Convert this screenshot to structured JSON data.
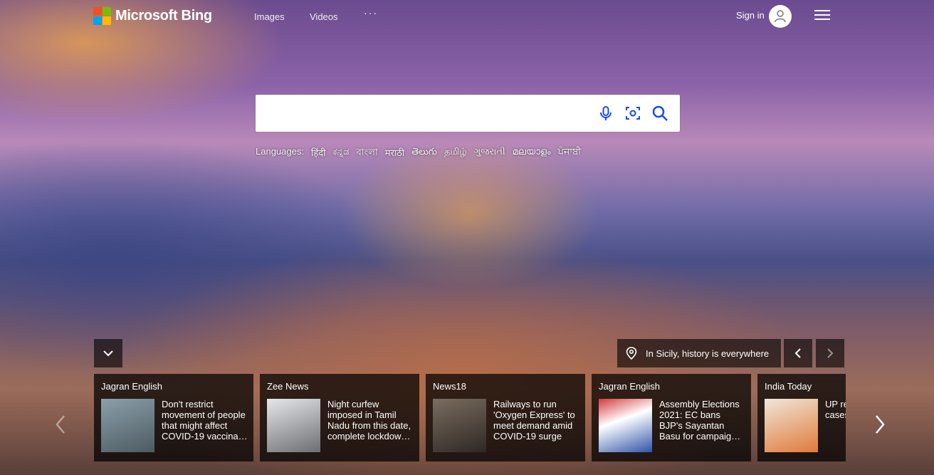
{
  "header": {
    "brand": "Microsoft Bing",
    "nav": [
      {
        "label": "Images"
      },
      {
        "label": "Videos"
      }
    ],
    "more": "···",
    "signin": "Sign in",
    "logo_colors": [
      "#f25022",
      "#7fba00",
      "#00a4ef",
      "#ffb900"
    ]
  },
  "search": {
    "placeholder": "",
    "value": ""
  },
  "languages": {
    "label": "Languages:",
    "items": [
      "हिंदी",
      "ಕನ್ನಡ",
      "বাংলা",
      "मराठी",
      "తెలుగు",
      "தமிழ்",
      "ગુજરાતી",
      "മലയാളം",
      "ਪੰਜਾਬੀ"
    ]
  },
  "image_caption": "In Sicily, history is everywhere",
  "news": [
    {
      "source": "Jagran English",
      "headline": "Don't restrict movement of people that might affect COVID-19 vaccina…",
      "thumb": "#6b7d86"
    },
    {
      "source": "Zee News",
      "headline": "Night curfew imposed in Tamil Nadu from this date, complete lockdow…",
      "thumb": "#c9cbd0"
    },
    {
      "source": "News18",
      "headline": "Railways to run 'Oxygen Express' to meet demand amid COVID-19 surge",
      "thumb": "#5a5148"
    },
    {
      "source": "Jagran English",
      "headline": "Assembly Elections 2021: EC bans BJP's Sayantan Basu for campaig…",
      "thumb": "#2f54a8"
    },
    {
      "source": "India Today",
      "headline": "UP re… fresh… cases… single…",
      "thumb": "#d99a6a"
    }
  ]
}
